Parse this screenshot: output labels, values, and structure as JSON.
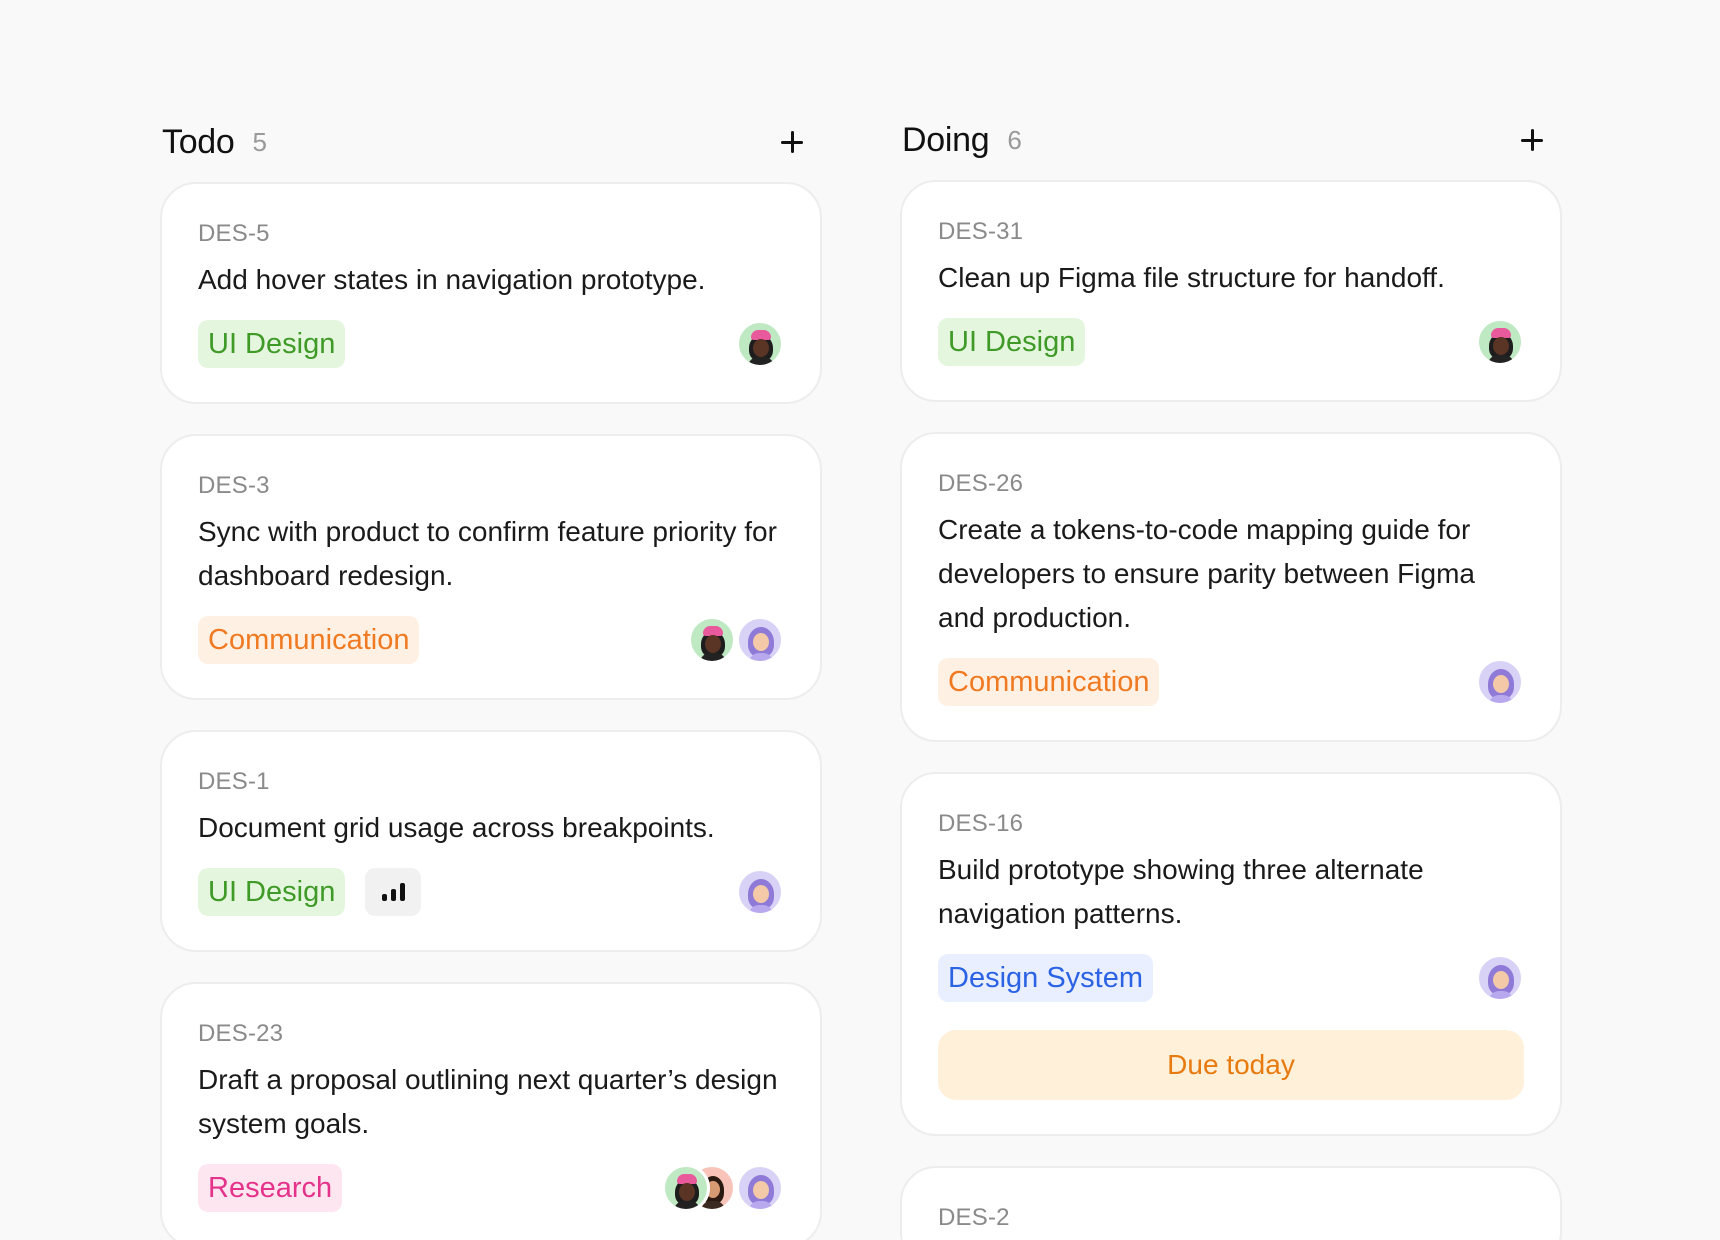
{
  "columns": [
    {
      "title": "Todo",
      "count": "5",
      "cards": [
        {
          "id": "DES-5",
          "title": "Add hover states in navigation prototype.",
          "tag": "UI Design"
        },
        {
          "id": "DES-3",
          "title": "Sync with product to confirm feature priority for dashboard redesign.",
          "tag": "Communication"
        },
        {
          "id": "DES-1",
          "title": "Document grid usage across breakpoints.",
          "tag": "UI Design",
          "priority": "high"
        },
        {
          "id": "DES-23",
          "title": "Draft a proposal outlining next quarter’s design system goals.",
          "tag": "Research"
        }
      ]
    },
    {
      "title": "Doing",
      "count": "6",
      "cards": [
        {
          "id": "DES-31",
          "title": "Clean up Figma file structure for handoff.",
          "tag": "UI Design"
        },
        {
          "id": "DES-26",
          "title": "Create a tokens-to-code mapping guide for developers to ensure parity between Figma and production.",
          "tag": "Communication"
        },
        {
          "id": "DES-16",
          "title": "Build prototype showing three alternate navigation patterns.",
          "tag": "Design System",
          "due": "Due today"
        },
        {
          "id": "DES-2"
        }
      ]
    }
  ],
  "colors": {
    "ui_design": "#3f9a27",
    "communication": "#ef7a22",
    "design_system": "#2b63e4",
    "research": "#e4338a",
    "due": "#e77b10"
  },
  "icons": {
    "add": "plus-icon",
    "priority": "signal-bars-icon"
  }
}
